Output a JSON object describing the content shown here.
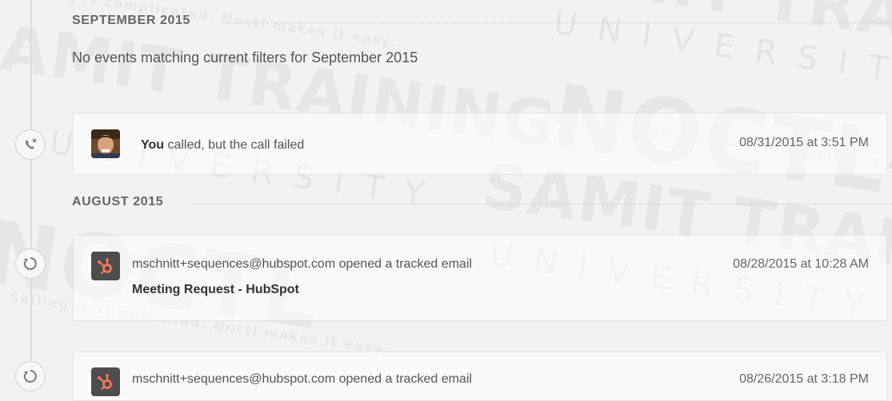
{
  "months": [
    {
      "heading": "SEPTEMBER 2015",
      "empty_message": "No events matching current filters for September 2015"
    },
    {
      "heading": "AUGUST 2015"
    }
  ],
  "events": [
    {
      "type": "call-failed",
      "actor": "You",
      "text": " called, but the call failed",
      "time": "08/31/2015 at 3:51 PM"
    },
    {
      "type": "email-opened",
      "text": "mschnitt+sequences@hubspot.com opened a tracked email",
      "subject": "Meeting Request - HubSpot",
      "time": "08/28/2015 at 10:28 AM"
    },
    {
      "type": "email-opened",
      "text": "mschnitt+sequences@hubspot.com opened a tracked email",
      "time": "08/26/2015 at 3:18 PM"
    }
  ],
  "watermark": {
    "brand": "SAMIT TRAINING",
    "university": "UNIVERSITY",
    "noctl": "NOCTL",
    "tagline": "Selling is complicated. Noctl makes it easy."
  },
  "colors": {
    "hubspot_orange": "#ff7a59",
    "timeline": "#dcdcdc",
    "background": "#f2f2f2"
  }
}
